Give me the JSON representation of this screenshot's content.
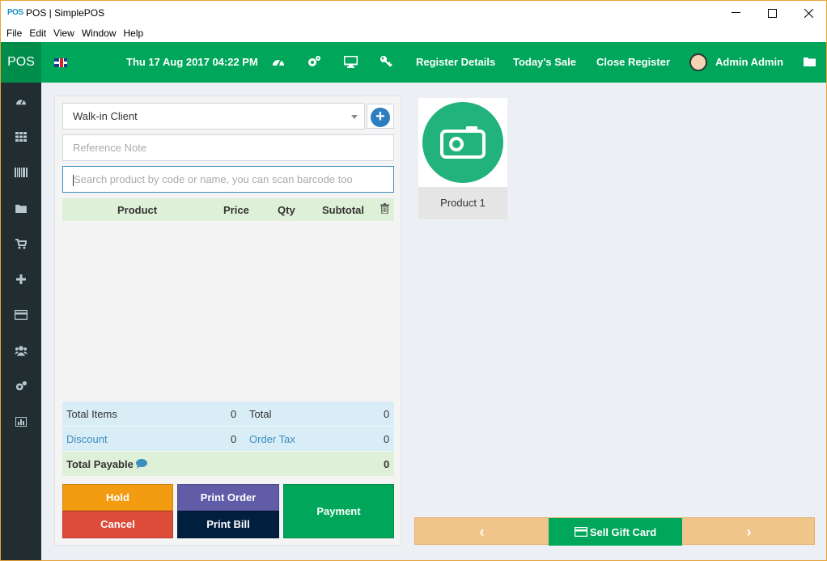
{
  "window": {
    "logo": "POS",
    "title": "POS | SimplePOS",
    "controls": [
      "minimize",
      "maximize",
      "close"
    ]
  },
  "menu": [
    "File",
    "Edit",
    "View",
    "Window",
    "Help"
  ],
  "topnav": {
    "brand": "POS",
    "datetime": "Thu 17 Aug 2017 04:22 PM",
    "links": {
      "register_details": "Register Details",
      "todays_sale": "Today's Sale",
      "close_register": "Close Register"
    },
    "user": "Admin Admin"
  },
  "sidebar_icons": [
    "dashboard-icon",
    "grid-icon",
    "barcode-icon",
    "folder-icon",
    "cart-icon",
    "plus-icon",
    "credit-card-icon",
    "users-icon",
    "settings-icon",
    "chart-icon"
  ],
  "order": {
    "client": "Walk-in Client",
    "reference_placeholder": "Reference Note",
    "search_placeholder": "Search product by code or name, you can scan barcode too",
    "columns": {
      "product": "Product",
      "price": "Price",
      "qty": "Qty",
      "subtotal": "Subtotal"
    },
    "totals": {
      "total_items_label": "Total Items",
      "total_items_value": "0",
      "total_label": "Total",
      "total_value": "0",
      "discount_label": "Discount",
      "discount_value": "0",
      "order_tax_label": "Order Tax",
      "order_tax_value": "0",
      "total_payable_label": "Total Payable",
      "total_payable_value": "0"
    },
    "buttons": {
      "hold": "Hold",
      "print_order": "Print Order",
      "cancel": "Cancel",
      "print_bill": "Print Bill",
      "payment": "Payment"
    }
  },
  "products": [
    {
      "name": "Product 1"
    }
  ],
  "footer": {
    "gift_card": "Sell Gift Card",
    "prev": "‹",
    "next": "›"
  },
  "colors": {
    "primary_green": "#00a65a",
    "sidebar": "#222d32",
    "hold": "#f39c12",
    "cancel": "#dd4b39",
    "print_order": "#605ca8",
    "print_bill": "#001f3f",
    "link_blue": "#3c8dbc"
  }
}
